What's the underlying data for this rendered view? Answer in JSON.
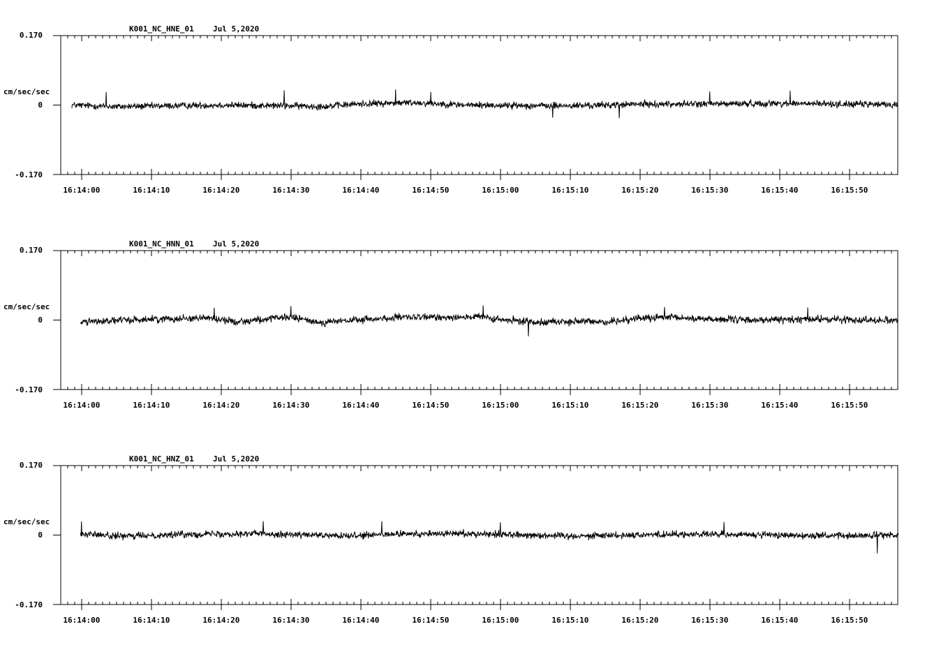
{
  "chart_data": [
    {
      "type": "line",
      "station": "K001_NC_HNE_01",
      "date": "Jul 5,2020",
      "ylabel": "cm/sec/sec",
      "ylim": [
        -0.17,
        0.17
      ],
      "ytick_labels": [
        "0.170",
        "0",
        "-0.170"
      ],
      "xtick_labels": [
        "16:14:00",
        "16:14:10",
        "16:14:20",
        "16:14:30",
        "16:14:40",
        "16:14:50",
        "16:15:00",
        "16:15:10",
        "16:15:20",
        "16:15:30",
        "16:15:40",
        "16:15:50"
      ],
      "trace_start": "16:13:58.6",
      "trace_end": "16:15:57",
      "noise_amplitude": 0.013,
      "envelope": [
        [
          -1.3,
          0.0
        ],
        [
          5,
          -0.004
        ],
        [
          20,
          0.0
        ],
        [
          35,
          -0.003
        ],
        [
          40,
          0.003
        ],
        [
          48,
          0.006
        ],
        [
          55,
          0.0
        ],
        [
          70,
          -0.002
        ],
        [
          80,
          0.002
        ],
        [
          100,
          0.004
        ],
        [
          117,
          0.001
        ]
      ],
      "spikes": [
        [
          3.5,
          0.032
        ],
        [
          29,
          0.036
        ],
        [
          45,
          0.038
        ],
        [
          50,
          0.032
        ],
        [
          67.5,
          -0.031
        ],
        [
          77,
          -0.032
        ],
        [
          90,
          0.033
        ],
        [
          101.5,
          0.035
        ]
      ]
    },
    {
      "type": "line",
      "station": "K001_NC_HNN_01",
      "date": "Jul 5,2020",
      "ylabel": "cm/sec/sec",
      "ylim": [
        -0.17,
        0.17
      ],
      "ytick_labels": [
        "0.170",
        "0",
        "-0.170"
      ],
      "xtick_labels": [
        "16:14:00",
        "16:14:10",
        "16:14:20",
        "16:14:30",
        "16:14:40",
        "16:14:50",
        "16:15:00",
        "16:15:10",
        "16:15:20",
        "16:15:30",
        "16:15:40",
        "16:15:50"
      ],
      "trace_start": "16:13:59.8",
      "trace_end": "16:15:57",
      "noise_amplitude": 0.014,
      "envelope": [
        [
          -0.2,
          -0.004
        ],
        [
          10,
          0.002
        ],
        [
          18,
          0.006
        ],
        [
          22,
          -0.004
        ],
        [
          30,
          0.007
        ],
        [
          34,
          -0.006
        ],
        [
          45,
          0.006
        ],
        [
          57,
          0.008
        ],
        [
          60,
          0.0
        ],
        [
          65,
          -0.004
        ],
        [
          76,
          -0.004
        ],
        [
          79,
          0.004
        ],
        [
          84,
          0.006
        ],
        [
          95,
          0.0
        ],
        [
          105,
          0.002
        ],
        [
          117,
          0.0
        ]
      ],
      "spikes": [
        [
          19,
          0.03
        ],
        [
          30,
          0.034
        ],
        [
          57.5,
          0.036
        ],
        [
          64,
          -0.04
        ],
        [
          83.5,
          0.032
        ],
        [
          104,
          0.031
        ]
      ]
    },
    {
      "type": "line",
      "station": "K001_NC_HNZ_01",
      "date": "Jul 5,2020",
      "ylabel": "cm/sec/sec",
      "ylim": [
        -0.17,
        0.17
      ],
      "ytick_labels": [
        "0.170",
        "0",
        "-0.170"
      ],
      "xtick_labels": [
        "16:14:00",
        "16:14:10",
        "16:14:20",
        "16:14:30",
        "16:14:40",
        "16:14:50",
        "16:15:00",
        "16:15:10",
        "16:15:20",
        "16:15:30",
        "16:15:40",
        "16:15:50"
      ],
      "trace_start": "16:13:59.8",
      "trace_end": "16:15:57",
      "noise_amplitude": 0.013,
      "envelope": [
        [
          -0.2,
          0.003
        ],
        [
          6,
          -0.003
        ],
        [
          15,
          0.002
        ],
        [
          25,
          0.004
        ],
        [
          38,
          -0.003
        ],
        [
          45,
          0.002
        ],
        [
          55,
          0.004
        ],
        [
          70,
          -0.002
        ],
        [
          85,
          0.002
        ],
        [
          100,
          0.0
        ],
        [
          110,
          -0.002
        ],
        [
          117,
          0.0
        ]
      ],
      "spikes": [
        [
          0,
          0.033
        ],
        [
          26,
          0.034
        ],
        [
          43,
          0.034
        ],
        [
          60,
          0.031
        ],
        [
          92,
          0.032
        ],
        [
          114,
          -0.045
        ]
      ]
    }
  ]
}
